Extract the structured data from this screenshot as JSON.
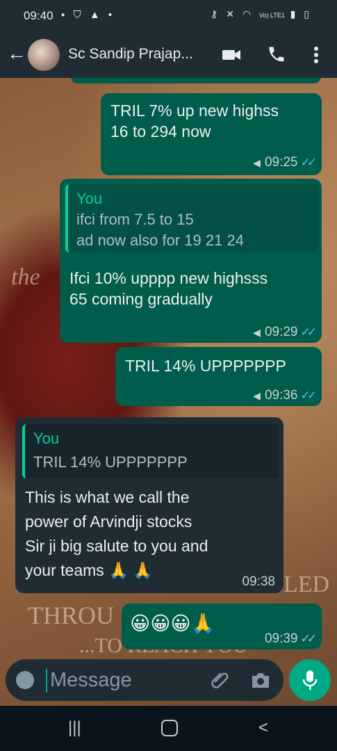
{
  "status_bar": {
    "time": "09:40",
    "network_label": "Vo) LTE1"
  },
  "header": {
    "contact_name": "Sc Sandip Prajap...",
    "icons": [
      "back-arrow-icon",
      "avatar",
      "video-call-icon",
      "phone-icon",
      "more-vert-icon"
    ]
  },
  "messages": [
    {
      "direction": "out",
      "text": "TRIL 7% up new highss\n16 to 294 now",
      "time": "09:25",
      "status": "read"
    },
    {
      "direction": "out",
      "quote_author": "You",
      "quote_text": "ifci from 7.5 to 15\nad now also for 19 21 24",
      "text": "Ifci 10% upppp new highsss\n65 coming gradually",
      "time": "09:29",
      "status": "read"
    },
    {
      "direction": "out",
      "text": "TRIL 14% UPPPPPPP",
      "time": "09:36",
      "status": "read"
    },
    {
      "direction": "in",
      "quote_author": "You",
      "quote_text": "TRIL 14% UPPPPPPP",
      "text": "This is what we call the\npower of Arvindji stocks\nSir ji big salute to you and\nyour teams 🙏 🙏",
      "time": "09:38"
    },
    {
      "direction": "out",
      "text": "😀😀😀🙏",
      "time": "09:39",
      "status": "delivered"
    }
  ],
  "input": {
    "placeholder": "Message"
  },
  "colors": {
    "outgoing_bubble": "#005c4b",
    "incoming_bubble": "#1f2c34",
    "accent": "#00a884",
    "read_ticks": "#53bdeb"
  }
}
